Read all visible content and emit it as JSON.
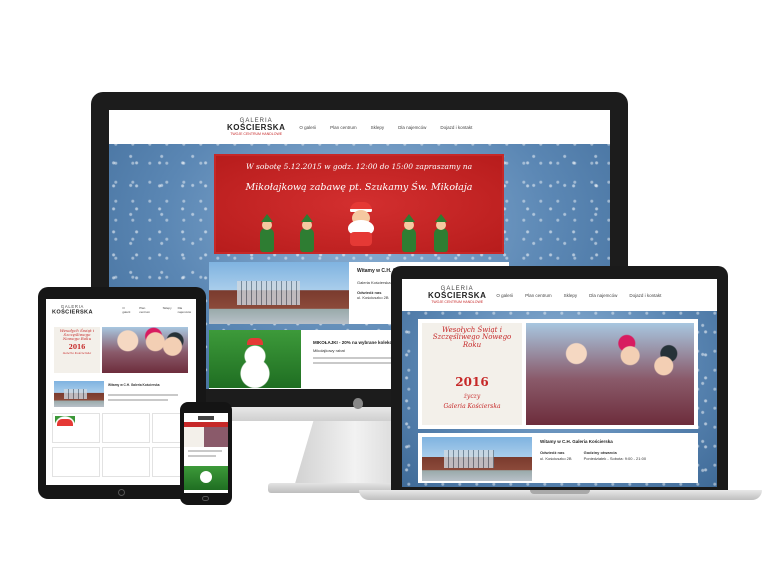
{
  "site": {
    "logo_line1": "GALERIA",
    "logo_line2": "KOŚCIERSKA",
    "logo_tagline": "TWOJE CENTRUM HANDLOWE"
  },
  "nav": [
    "O galerii",
    "Plan centrum",
    "Sklepy",
    "Dla najemców",
    "Dojazd i kontakt"
  ],
  "desktop": {
    "promo_line1": "W sobotę 5.12.2015 w godz. 12:00 do 15:00 zapraszamy na",
    "promo_line2": "Mikołajkową zabawę pt. Szukamy Św. Mikołaja",
    "welcome_title": "Witamy w C.H. Galeria Kościerska",
    "welcome_text": "Galeria Kościerska",
    "address_label": "Odwiedź nas",
    "address_text": "ul. Kościuszko 2B",
    "news_title": "MIKOŁAJKI - 20% na wybrane kolekcje",
    "news_text": "Mikołajkowy rabat"
  },
  "laptop": {
    "poster_line1": "Wesołych Świąt i Szczęśliwego Nowego Roku",
    "poster_year": "2016",
    "poster_line2": "życzy",
    "poster_line3": "Galeria Kościerska",
    "welcome_title": "Witamy w C.H. Galeria Kościerska",
    "address_label": "Odwiedź nas",
    "address_text": "ul. Kościuszko 2B",
    "hours_label": "Godziny otwarcia",
    "hours_text": "Poniedziałek - Sobota: 9:00 - 21:00"
  },
  "tablet": {
    "poster_line1": "Wesołych Świąt i Szczęśliwego Nowego Roku",
    "poster_year": "2016",
    "poster_line2": "Galeria Kościerska",
    "welcome_title": "Witamy w C.H. Galeria Kościerska"
  }
}
